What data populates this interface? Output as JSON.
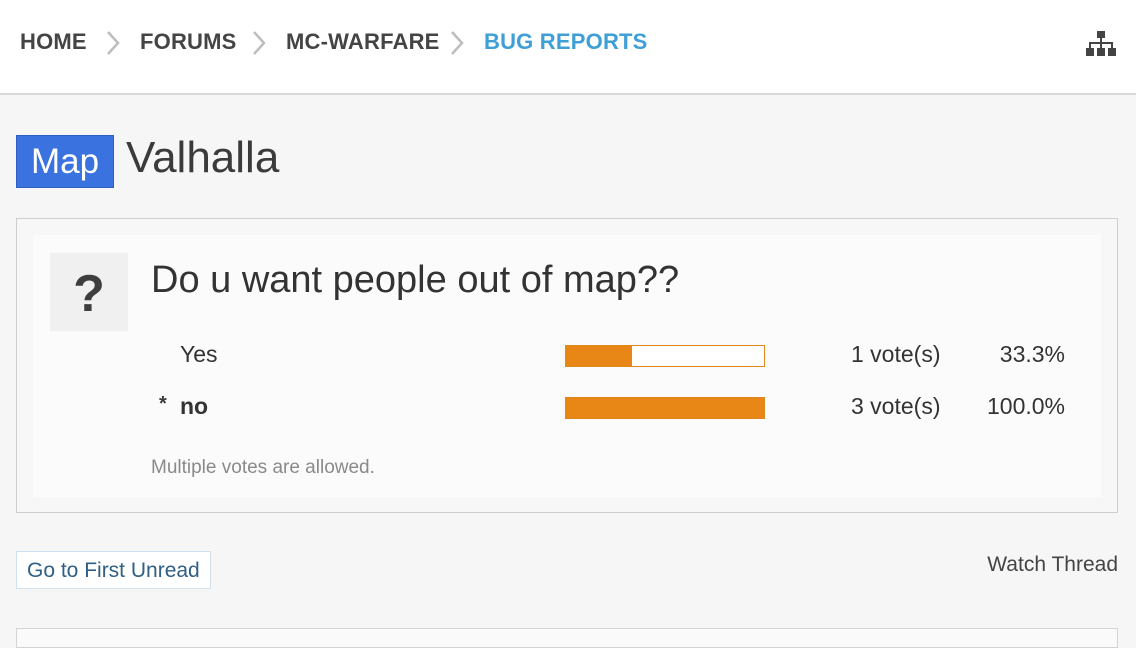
{
  "breadcrumb": {
    "items": [
      {
        "label": "HOME"
      },
      {
        "label": "FORUMS"
      },
      {
        "label": "MC-WARFARE"
      },
      {
        "label": "BUG REPORTS"
      }
    ]
  },
  "thread": {
    "prefix": "Map",
    "title": "Valhalla"
  },
  "poll": {
    "question_icon": "?",
    "question": "Do u want people out of map??",
    "options": [
      {
        "label": "Yes",
        "voted": false,
        "votes": "1 vote(s)",
        "percent": "33.3%",
        "fill": 0.333
      },
      {
        "label": "no",
        "voted": true,
        "mark": "*",
        "votes": "3 vote(s)",
        "percent": "100.0%",
        "fill": 1.0
      }
    ],
    "note": "Multiple votes are allowed."
  },
  "actions": {
    "first_unread": "Go to First Unread",
    "watch": "Watch Thread"
  },
  "colors": {
    "accent": "#3f9fd6",
    "prefix_bg": "#3a72e0",
    "bar": "#e98716"
  }
}
